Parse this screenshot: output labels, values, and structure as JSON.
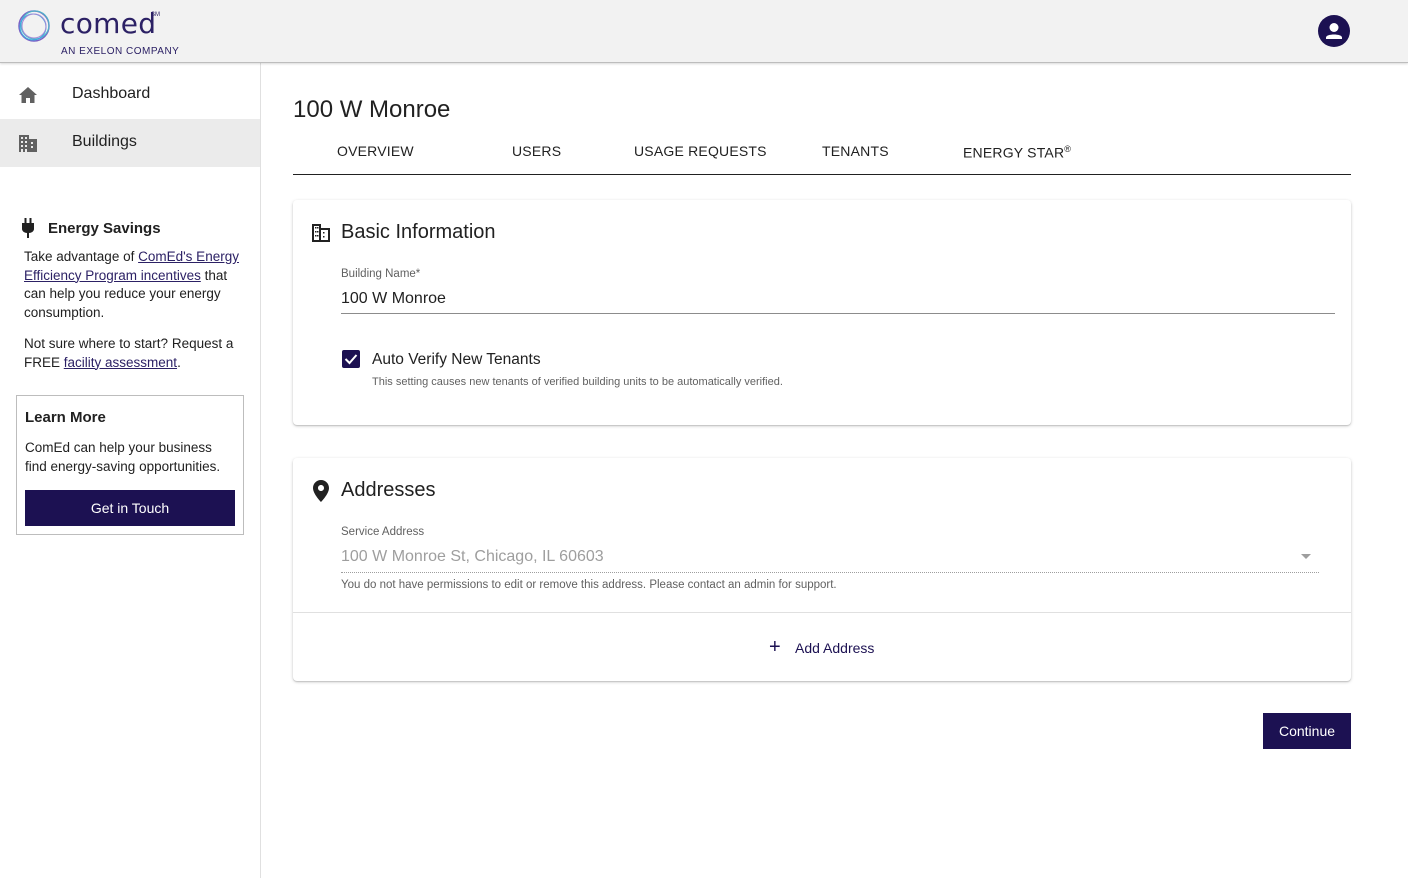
{
  "header": {
    "brand": "comed",
    "brand_mark": "SM",
    "brand_sub": "AN EXELON COMPANY",
    "avatar_icon": "account-circle-icon"
  },
  "sidebar": {
    "items": [
      {
        "label": "Dashboard",
        "icon": "home-icon",
        "active": false
      },
      {
        "label": "Buildings",
        "icon": "building-icon",
        "active": true
      }
    ],
    "energy_savings": {
      "title": "Energy Savings",
      "text_before": "Take advantage of ",
      "link1": "ComEd's Energy Efficiency Program incentives",
      "text_after": " that can help you reduce your energy consumption.",
      "text2_before": "Not sure where to start? Request a FREE ",
      "link2": "facility assessment",
      "text2_after": "."
    },
    "learn_more": {
      "title": "Learn More",
      "text": "ComEd can help your business find energy-saving opportunities.",
      "button": "Get in Touch"
    }
  },
  "page": {
    "title": "100 W Monroe",
    "tabs": [
      "OVERVIEW",
      "USERS",
      "USAGE REQUESTS",
      "TENANTS",
      "ENERGY STAR"
    ],
    "tab_sup": "®"
  },
  "basic_info": {
    "title": "Basic Information",
    "building_name_label": "Building Name",
    "required_mark": "*",
    "building_name_value": "100 W Monroe",
    "auto_verify_label": "Auto Verify New Tenants",
    "auto_verify_checked": true,
    "auto_verify_help": "This setting causes new tenants of verified building units to be automatically verified."
  },
  "addresses": {
    "title": "Addresses",
    "service_address_label": "Service Address",
    "service_address_value": "100 W Monroe St, Chicago, IL 60603",
    "help": "You do not have permissions to edit or remove this address. Please contact an admin for support.",
    "add_button": "Add Address",
    "add_icon": "+"
  },
  "footer": {
    "continue": "Continue"
  },
  "colors": {
    "primary": "#1c1152",
    "brand": "#2c2165"
  }
}
